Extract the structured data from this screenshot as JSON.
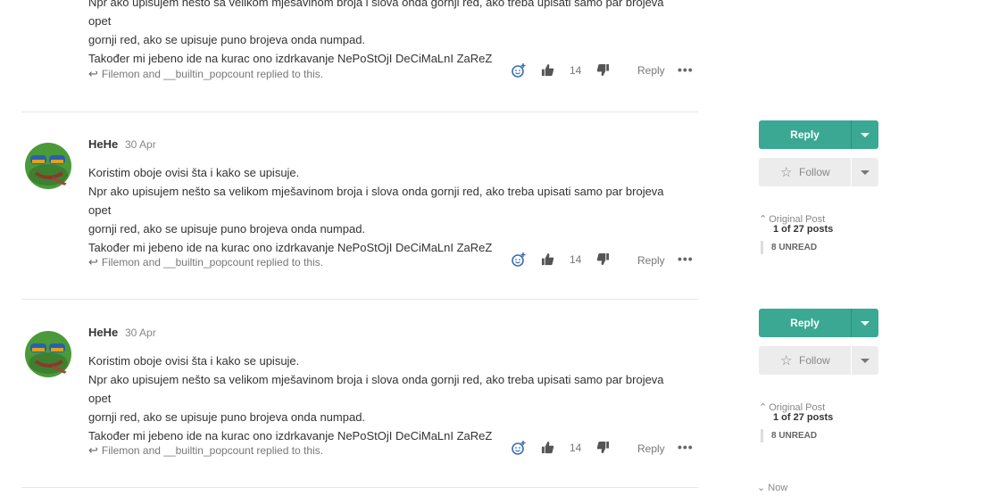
{
  "posts": [
    {
      "author": "",
      "date": "",
      "lines": [
        "Npr ako upisujem nešto sa velikom mješavinom broja i slova onda gornji red, ako treba upisati samo par brojeva opet",
        "gornji red, ako se upisuje puno brojeva onda numpad.",
        "Također mi jebeno ide na kurac ono izdrkavanje NePoStOjI DeCiMaLnI ZaReZ"
      ],
      "replied": "Filemon and __builtin_popcount replied to this.",
      "likes": "14",
      "reply_label": "Reply",
      "more": "•••"
    },
    {
      "author": "HeHe",
      "date": "30 Apr",
      "lines": [
        "Koristim oboje ovisi šta i kako se upisuje.",
        "Npr ako upisujem nešto sa velikom mješavinom broja i slova onda gornji red, ako treba upisati samo par brojeva opet",
        "gornji red, ako se upisuje puno brojeva onda numpad.",
        "Također mi jebeno ide na kurac ono izdrkavanje NePoStOjI DeCiMaLnI ZaReZ"
      ],
      "replied": "Filemon and __builtin_popcount replied to this.",
      "likes": "14",
      "reply_label": "Reply",
      "more": "•••"
    },
    {
      "author": "HeHe",
      "date": "30 Apr",
      "lines": [
        "Koristim oboje ovisi šta i kako se upisuje.",
        "Npr ako upisujem nešto sa velikom mješavinom broja i slova onda gornji red, ako treba upisati samo par brojeva opet",
        "gornji red, ako se upisuje puno brojeva onda numpad.",
        "Također mi jebeno ide na kurac ono izdrkavanje NePoStOjI DeCiMaLnI ZaReZ"
      ],
      "replied": "Filemon and __builtin_popcount replied to this.",
      "likes": "14",
      "reply_label": "Reply",
      "more": "•••"
    }
  ],
  "sidebar": {
    "reply_label": "Reply",
    "follow_label": "Follow",
    "original_post": "Original Post",
    "position": "1 of 27 posts",
    "unread": "8 UNREAD",
    "now": "Now"
  },
  "colors": {
    "accent": "#3aa893",
    "follow_bg": "#ececec"
  },
  "icons": [
    "reply-arrow-icon",
    "add-reaction-icon",
    "thumbs-up-icon",
    "thumbs-down-icon",
    "star-icon",
    "chevron-up-icon",
    "chevron-down-icon",
    "caret-down-icon",
    "more-icon"
  ]
}
